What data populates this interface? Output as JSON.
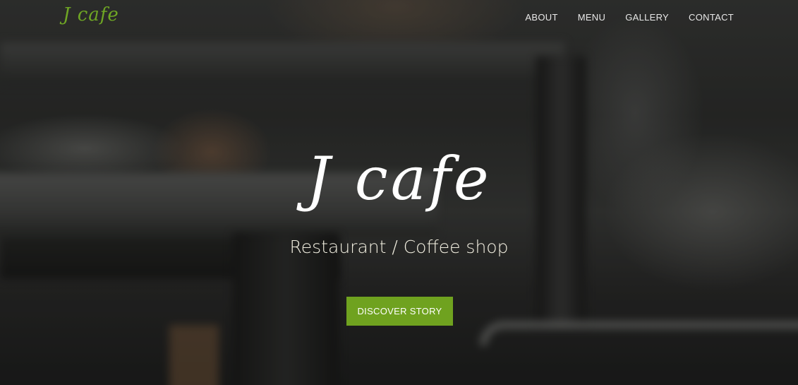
{
  "brand": {
    "logo_text": "J cafe",
    "accent_color": "#6fa21f"
  },
  "nav": {
    "items": [
      {
        "label": "ABOUT"
      },
      {
        "label": "MENU"
      },
      {
        "label": "GALLERY"
      },
      {
        "label": "CONTACT"
      }
    ]
  },
  "hero": {
    "title": "J cafe",
    "subtitle": "Restaurant / Coffee shop",
    "cta_label": "DISCOVER STORY",
    "background": "blurred-cafe-tables-photo"
  }
}
